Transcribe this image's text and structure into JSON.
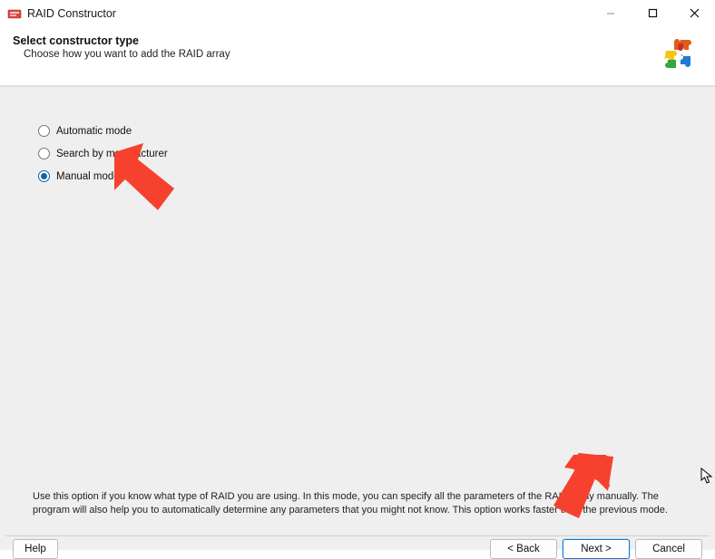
{
  "window": {
    "title": "RAID Constructor"
  },
  "header": {
    "title": "Select constructor type",
    "subtitle": "Choose how you want to add the RAID array"
  },
  "options": {
    "automatic": "Automatic mode",
    "search_manufacturer": "Search by manufacturer",
    "manual": "Manual mode",
    "selected": "manual"
  },
  "description": "Use this option if you know what type of RAID you are using. In this mode, you can specify all the parameters of the RAID array manually. The program will also help you to automatically determine any parameters that you might not know. This option works faster than the previous mode.",
  "buttons": {
    "help": "Help",
    "back": "< Back",
    "next": "Next >",
    "cancel": "Cancel"
  },
  "annotations": {
    "arrow1": true,
    "arrow2": true
  }
}
